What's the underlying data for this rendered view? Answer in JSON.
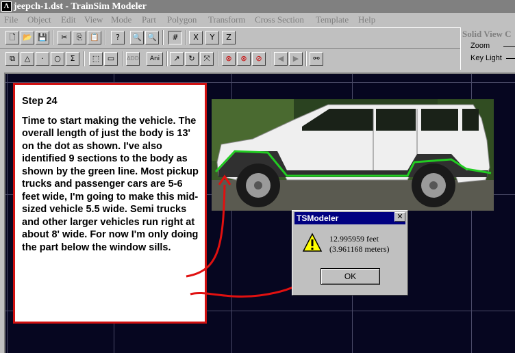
{
  "window": {
    "title": "jeepch-1.dst - TrainSim Modeler",
    "app_icon_glyph": "Λ"
  },
  "menu": [
    "File",
    "Object",
    "Edit",
    "View",
    "Mode",
    "Part",
    "Polygon",
    "Transform",
    "Cross Section",
    "Template",
    "Help"
  ],
  "toolbar_row1": [
    {
      "icon": "new-file-icon",
      "glyph": "🗋"
    },
    {
      "icon": "open-folder-icon",
      "glyph": "📂"
    },
    {
      "icon": "save-icon",
      "glyph": "💾"
    },
    {
      "icon": "cut-icon",
      "glyph": "✂"
    },
    {
      "icon": "copy-icon",
      "glyph": "⎘"
    },
    {
      "icon": "paste-icon",
      "glyph": "📋"
    },
    {
      "icon": "help-icon",
      "glyph": "?"
    },
    {
      "icon": "zoom-in-icon",
      "glyph": "🔍"
    },
    {
      "icon": "zoom-out-icon",
      "glyph": "🔍"
    },
    {
      "icon": "grid-icon",
      "glyph": "#"
    },
    {
      "icon": "align-x-icon",
      "glyph": "X"
    },
    {
      "icon": "align-y-icon",
      "glyph": "Y"
    },
    {
      "icon": "align-z-icon",
      "glyph": "Z"
    }
  ],
  "toolbar_row2": [
    {
      "icon": "select-part-icon",
      "glyph": "⧉"
    },
    {
      "icon": "triangle-icon",
      "glyph": "△"
    },
    {
      "icon": "point-icon",
      "glyph": "·"
    },
    {
      "icon": "circle-icon",
      "glyph": "○"
    },
    {
      "icon": "sigma-icon",
      "glyph": "Σ"
    },
    {
      "icon": "select-box-icon",
      "glyph": "⬚"
    },
    {
      "icon": "ruler-icon",
      "glyph": "▭"
    },
    {
      "icon": "add-icon",
      "glyph": "ADD"
    },
    {
      "icon": "animation-icon",
      "glyph": "Ani"
    },
    {
      "icon": "move-icon",
      "glyph": "↗"
    },
    {
      "icon": "rotate-icon",
      "glyph": "↻"
    },
    {
      "icon": "scale-icon",
      "glyph": "⤧"
    },
    {
      "icon": "no-x-icon",
      "glyph": "⊗"
    },
    {
      "icon": "no-y-icon",
      "glyph": "⊗"
    },
    {
      "icon": "no-z-icon",
      "glyph": "⊘"
    },
    {
      "icon": "prev-icon",
      "glyph": "◀"
    },
    {
      "icon": "next-icon",
      "glyph": "▶"
    },
    {
      "icon": "binoculars-icon",
      "glyph": "⚯"
    }
  ],
  "view_panel": {
    "title": "Solid View C",
    "zoom_label": "Zoom",
    "keylight_label": "Key Light"
  },
  "note": {
    "step": "Step 24",
    "body": "Time to start making the vehicle. The overall length of just the body is 13' on the dot as shown. I've also identified 9 sections to the body as shown by the green line. Most pickup trucks and passenger cars are 5-6 feet wide, I'm going to make this mid-sized vehicle 5.5 wide. Semi trucks and other larger vehicles run right at about 8' wide. For now I'm only doing the part below the window sills."
  },
  "dialog": {
    "title": "TSModeler",
    "line1": "12.995959 feet",
    "line2": "(3.961168 meters)",
    "ok_label": "OK"
  },
  "colors": {
    "viewport_bg": "#060620",
    "note_border": "#d01010",
    "annotation_arrow": "#e01010",
    "section_line": "#22cc22",
    "dialog_title": "#000080"
  }
}
